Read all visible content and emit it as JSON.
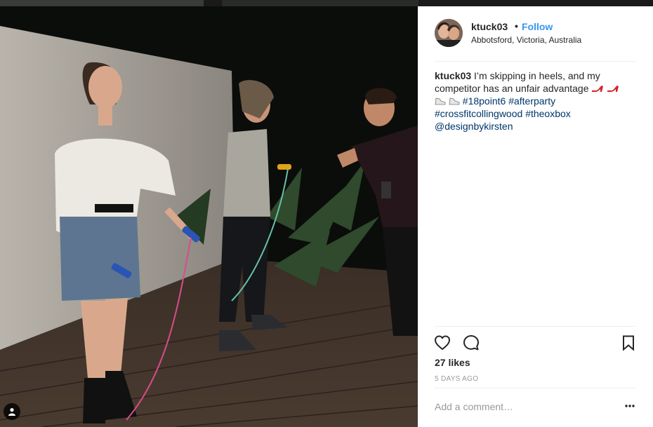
{
  "post": {
    "username": "ktuck03",
    "separator": "•",
    "follow_label": "Follow",
    "location": "Abbotsford, Victoria, Australia",
    "caption": {
      "user": "ktuck03",
      "text": "I’m skipping in heels, and my competitor has an unfair advantage",
      "hashtags": [
        "#18point6",
        "#afterparty",
        "#crossfitcollingwood",
        "#theoxbox"
      ],
      "mention": "@designbykirsten"
    },
    "likes": "27 likes",
    "time_ago": "5 DAYS AGO",
    "comment_placeholder": "Add a comment…"
  },
  "icons": {
    "like": "heart-icon",
    "comment": "comment-bubble-icon",
    "save": "bookmark-icon",
    "more": "more-options-icon",
    "tagged": "user-tag-icon"
  },
  "colors": {
    "link_blue": "#3897f0",
    "hashtag": "#003569",
    "muted": "#999999",
    "text": "#262626"
  }
}
